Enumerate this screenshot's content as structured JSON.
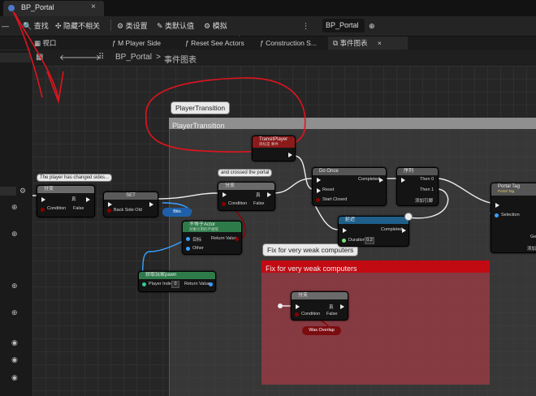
{
  "doc_tab": {
    "title": "BP_Portal",
    "close": "×"
  },
  "toolbar": {
    "find": "查找",
    "hide_unrelated": "隐藏不相关",
    "class_settings": "类设置",
    "class_defaults": "类默认值",
    "simulate": "模拟",
    "bp_selector": "BP_Portal"
  },
  "graph_tabs": [
    "视口",
    "M Player Side",
    "Reset See Actors",
    "Construction S...",
    "事件图表"
  ],
  "breadcrumb": {
    "root": "BP_Portal",
    "sep": ">",
    "current": "事件图表"
  },
  "comments": {
    "player_transition_bubble": "PlayerTransition",
    "player_transition_title": "PlayerTransition",
    "weak_bubble": "Fix for very weak computers",
    "weak_title": "Fix for very weak computers"
  },
  "bubbles": {
    "side_changed": "The player has changed sides...",
    "crossed_portal": "and crossed the portal"
  },
  "nodes": {
    "branch1": {
      "title": "分支",
      "pin_cond": "Condition",
      "pin_true": "真",
      "pin_false": "False"
    },
    "set": {
      "title": "SET",
      "pin_back": "Back Side Old"
    },
    "branch2": {
      "title": "分支",
      "pin_cond": "Condition",
      "pin_true": "真",
      "pin_false": "False"
    },
    "bito": {
      "title": "Bito"
    },
    "is_valid": {
      "title": "不等于Actor",
      "sub": "对象引用的不相等",
      "pin_a": "目标",
      "pin_rv": "Return Value",
      "pin_other": "Other"
    },
    "get_pawn": {
      "title": "获取玩家pawn",
      "pin_idx": "Player Index",
      "idx_val": "0",
      "pin_rv": "Return Value"
    },
    "transit": {
      "title": "TransitPlayer",
      "sub": "目标是 事件"
    },
    "do_once": {
      "title": "Do Once",
      "pin_completed": "Completed",
      "pin_reset": "Reset",
      "pin_start": "Start Closed"
    },
    "sequence": {
      "title": "序列",
      "pin_then0": "Then 0",
      "pin_then1": "Then 1",
      "pin_add": "添加引脚"
    },
    "delay": {
      "title": "延迟",
      "pin_completed": "Completed",
      "pin_duration": "Duration",
      "dur_val": "0.2"
    },
    "portal_tag": {
      "title": "Portal Tag",
      "sub": "Portal Tag",
      "pin_sel": "Selection",
      "pin_ge": "Ge",
      "pin_add": "添加"
    },
    "branch3": {
      "title": "分支",
      "pin_cond": "Condition",
      "pin_true": "真",
      "pin_false": "False"
    },
    "was_overlap": {
      "title": "Was Overlap"
    }
  },
  "colors": {
    "accent_red_annotation": "#e0141e",
    "exec_white": "#eeeeee",
    "bool_red": "#8b0000",
    "object_blue": "#3aa0ff",
    "play_green": "#2ecc40"
  }
}
